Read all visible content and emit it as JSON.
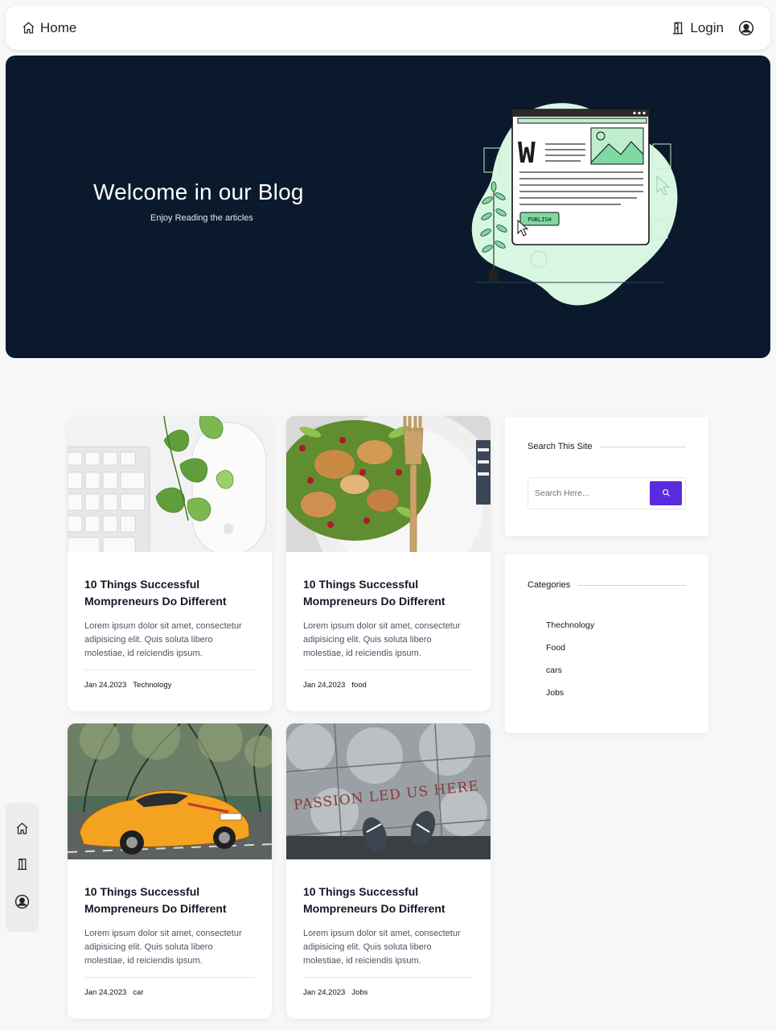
{
  "nav": {
    "home_label": "Home",
    "login_label": "Login",
    "icons": [
      "home-icon",
      "door-icon",
      "user-circle-icon"
    ]
  },
  "hero": {
    "title": "Welcome in our Blog",
    "subtitle": "Enjoy Reading the articles",
    "illustration": {
      "letter": "W",
      "button_label": "PUBLISH"
    }
  },
  "posts": [
    {
      "title": "10 Things Successful Mompreneurs Do Different",
      "excerpt": "Lorem ipsum dolor sit amet, consectetur adipisicing elit. Quis soluta libero molestiae, id reiciendis ipsum.",
      "date": "Jan 24,2023",
      "category": "Technology",
      "image": "keyboard-mouse-plant-photo"
    },
    {
      "title": "10 Things Successful Mompreneurs Do Different",
      "excerpt": "Lorem ipsum dolor sit amet, consectetur adipisicing elit. Quis soluta libero molestiae, id reiciendis ipsum.",
      "date": "Jan 24,2023",
      "category": "food",
      "image": "salad-plate-photo"
    },
    {
      "title": "10 Things Successful Mompreneurs Do Different",
      "excerpt": "Lorem ipsum dolor sit amet, consectetur adipisicing elit. Quis soluta libero molestiae, id reiciendis ipsum.",
      "date": "Jan 24,2023",
      "category": "car",
      "image": "yellow-sports-car-photo"
    },
    {
      "title": "10 Things Successful Mompreneurs Do Different",
      "excerpt": "Lorem ipsum dolor sit amet, consectetur adipisicing elit. Quis soluta libero molestiae, id reiciendis ipsum.",
      "date": "Jan 24,2023",
      "category": "Jobs",
      "image": "passion-led-us-here-pavement-photo",
      "image_text": "PASSION LED US HERE"
    }
  ],
  "sidebar": {
    "search": {
      "heading": "Search This Site",
      "placeholder": "Search Here..."
    },
    "categories": {
      "heading": "Categories",
      "items": [
        "Thechnology",
        "Food",
        "cars",
        "Jobs"
      ]
    }
  },
  "colors": {
    "hero_bg": "#0b192c",
    "accent": "#5b2be0",
    "illustration_green": "#d8f7e2"
  }
}
